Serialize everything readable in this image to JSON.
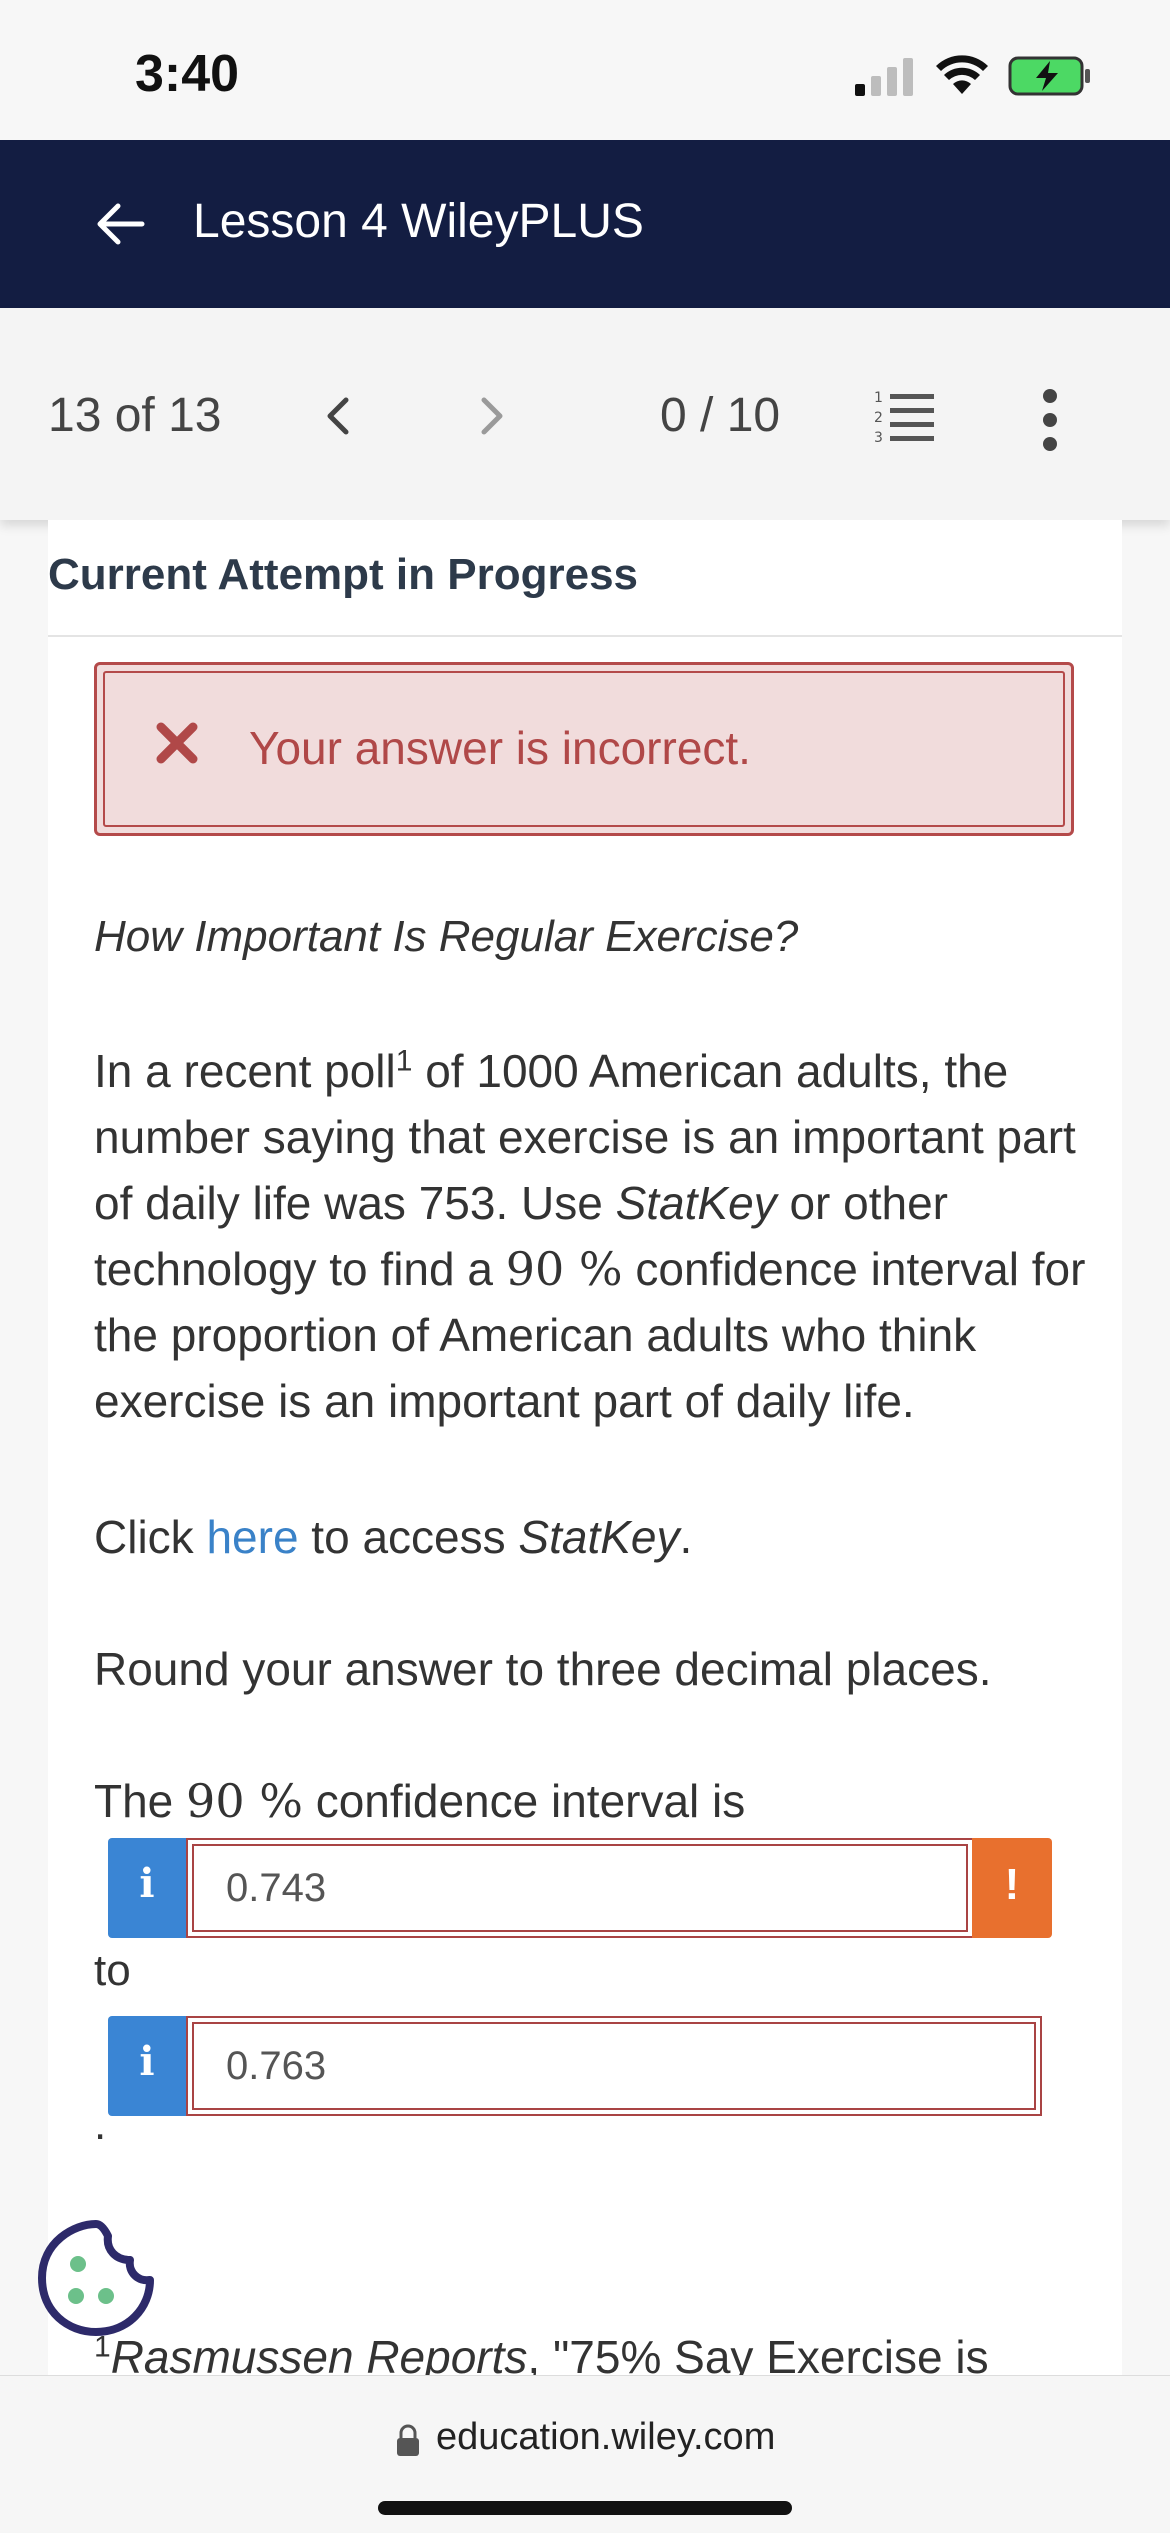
{
  "status_bar": {
    "time": "3:40"
  },
  "header": {
    "title": "Lesson 4 WileyPLUS"
  },
  "toolbar": {
    "position": "13 of 13",
    "score": "0 / 10"
  },
  "card": {
    "attempt_title": "Current Attempt in Progress",
    "error_message": "Your answer is incorrect.",
    "question_title": "How Important Is Regular Exercise?",
    "para1": {
      "t1": "In a recent poll",
      "sup": "1",
      "t2": " of 1000 American adults, the number saying that exercise is an important part of daily life was 753. Use ",
      "statkey": "StatKey",
      "t3": " or other technology to find a ",
      "conf": "90 %",
      "t4": "  confidence interval for the proportion of American adults who think exercise is an important part of daily life."
    },
    "para2": {
      "t1": "Click ",
      "link": "here",
      "t2": " to access ",
      "statkey": "StatKey",
      "t3": "."
    },
    "para3": "Round your answer to three decimal places.",
    "para4": {
      "t1": "The ",
      "conf": "90 %",
      "t2": "  confidence interval is"
    },
    "answer1": {
      "info": "i",
      "value": "0.743",
      "warn": "!"
    },
    "to_label": "to",
    "answer2": {
      "info": "i",
      "value": "0.763"
    },
    "period": ".",
    "footnote": {
      "sup": "1",
      "source": "Rasmussen Reports",
      "rest": ", \"75% Say Exercise is"
    }
  },
  "url_bar": {
    "url": "education.wiley.com"
  },
  "colors": {
    "header_bg": "#131d42",
    "error_bg": "#f1dcdc",
    "error_border": "#b44a4a",
    "info_blue": "#3a85d4",
    "warn_orange": "#e8702e",
    "link": "#3a82c8"
  }
}
